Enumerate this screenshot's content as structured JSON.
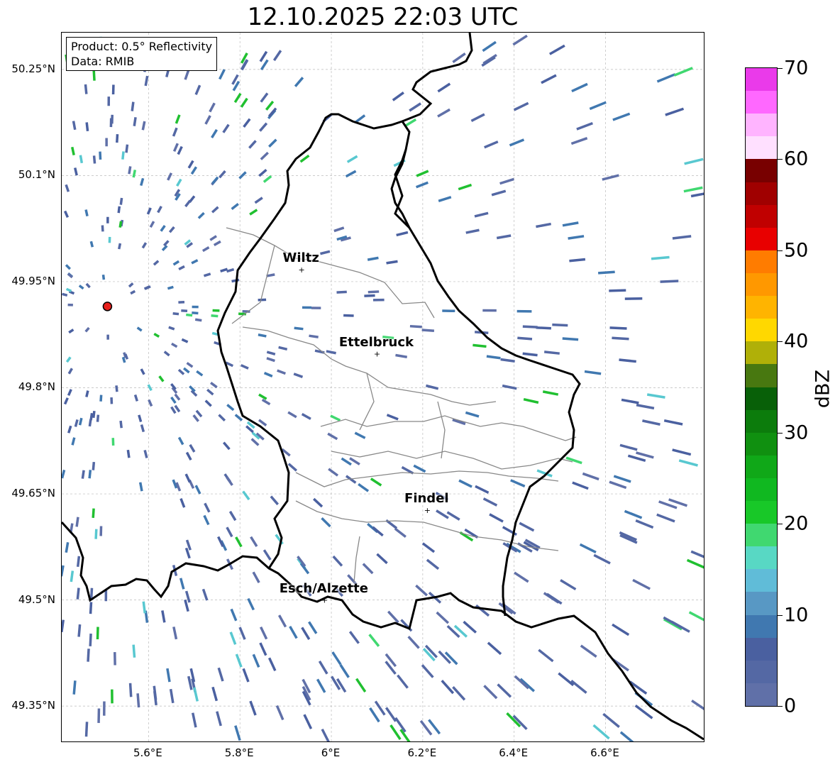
{
  "title": "12.10.2025 22:03 UTC",
  "info": {
    "product": "Product: 0.5° Reflectivity",
    "source": "Data: RMIB"
  },
  "map": {
    "lon_range": [
      5.41,
      6.815
    ],
    "lat_range": [
      49.3,
      50.302
    ],
    "lat_ticks": [
      {
        "value": 50.25,
        "label": "50.25°N"
      },
      {
        "value": 50.1,
        "label": "50.1°N"
      },
      {
        "value": 49.95,
        "label": "49.95°N"
      },
      {
        "value": 49.8,
        "label": "49.8°N"
      },
      {
        "value": 49.65,
        "label": "49.65°N"
      },
      {
        "value": 49.5,
        "label": "49.5°N"
      },
      {
        "value": 49.35,
        "label": "49.35°N"
      }
    ],
    "lon_ticks": [
      {
        "value": 5.6,
        "label": "5.6°E"
      },
      {
        "value": 5.8,
        "label": "5.8°E"
      },
      {
        "value": 6.0,
        "label": "6°E"
      },
      {
        "value": 6.2,
        "label": "6.2°E"
      },
      {
        "value": 6.4,
        "label": "6.4°E"
      },
      {
        "value": 6.6,
        "label": "6.6°E"
      }
    ],
    "radar_site": {
      "lon": 5.51,
      "lat": 49.915,
      "color": "#e8201c"
    },
    "cities": [
      {
        "name": "Wiltz",
        "lon": 5.935,
        "lat": 49.967
      },
      {
        "name": "Ettelbruck",
        "lon": 6.1,
        "lat": 49.848
      },
      {
        "name": "Findel",
        "lon": 6.21,
        "lat": 49.627
      },
      {
        "name": "Esch/Alzette",
        "lon": 5.985,
        "lat": 49.5
      }
    ]
  },
  "colorbar": {
    "label": "dBZ",
    "min": 0,
    "max": 70,
    "ticks": [
      {
        "value": 0,
        "label": "0"
      },
      {
        "value": 10,
        "label": "10"
      },
      {
        "value": 20,
        "label": "20"
      },
      {
        "value": 30,
        "label": "30"
      },
      {
        "value": 40,
        "label": "40"
      },
      {
        "value": 50,
        "label": "50"
      },
      {
        "value": 60,
        "label": "60"
      },
      {
        "value": 70,
        "label": "70"
      }
    ],
    "colors": [
      "#6070a8",
      "#5468a4",
      "#4a60a0",
      "#4078b0",
      "#5898c4",
      "#60bcd8",
      "#58d8c4",
      "#40d870",
      "#18c828",
      "#10b820",
      "#10a818",
      "#109010",
      "#0c7c0c",
      "#086008",
      "#487810",
      "#b0b008",
      "#ffd800",
      "#ffb400",
      "#ff9800",
      "#ff7c00",
      "#e80000",
      "#c00000",
      "#a00000",
      "#780000",
      "#ffe0ff",
      "#ffb4ff",
      "#ff68ff",
      "#ea3aea"
    ]
  }
}
